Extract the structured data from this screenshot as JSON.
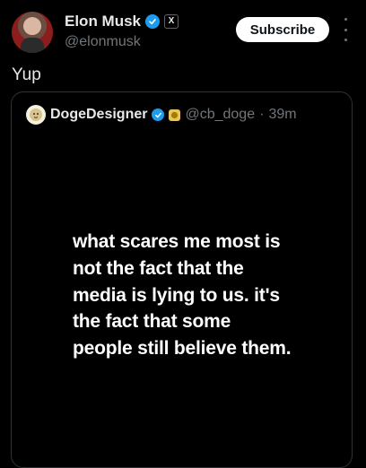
{
  "author": {
    "name": "Elon Musk",
    "handle": "@elonmusk",
    "badge_text": "X",
    "subscribe_label": "Subscribe"
  },
  "post": {
    "text": "Yup"
  },
  "quoted": {
    "name": "DogeDesigner",
    "handle": "@cb_doge",
    "time": "39m",
    "separator": "·",
    "image_text": "what scares me most is not the fact that the media is lying to us. it's the fact that some people still believe them."
  },
  "colors": {
    "background": "#000000",
    "verified": "#1d9bf0",
    "secondary_text": "#71767b"
  }
}
